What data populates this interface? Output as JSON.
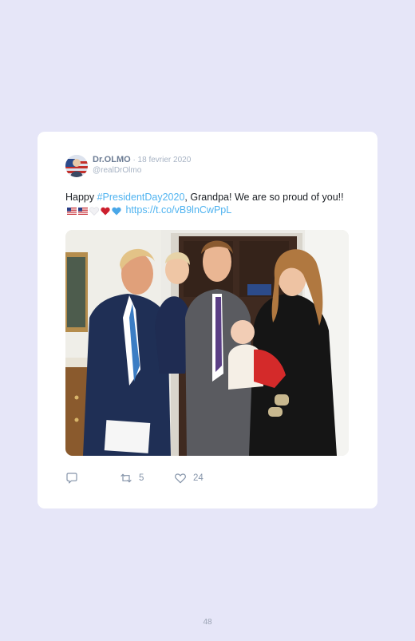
{
  "tweet": {
    "author_name": "Dr.OLMO",
    "date": " · 18 fevrier 2020",
    "handle": "@realDrOlmo",
    "text_before": "Happy ",
    "hashtag": "#PresidentDay2020",
    "text_after": ", Grandpa! We are so proud of you!! ",
    "link": "https://t.co/vB9lnCwPpL",
    "emoji": [
      "us-flag-icon",
      "us-flag-icon",
      "white-heart-icon",
      "red-heart-icon",
      "blue-heart-icon"
    ],
    "photo_description_icon": "family-photo",
    "actions": {
      "reply_count": "",
      "retweet_count": "5",
      "like_count": "24"
    }
  },
  "page": {
    "number": "48"
  },
  "colors": {
    "background": "#e6e6f8",
    "card": "#ffffff",
    "link": "#4fb3f0",
    "muted": "#8695aa"
  }
}
